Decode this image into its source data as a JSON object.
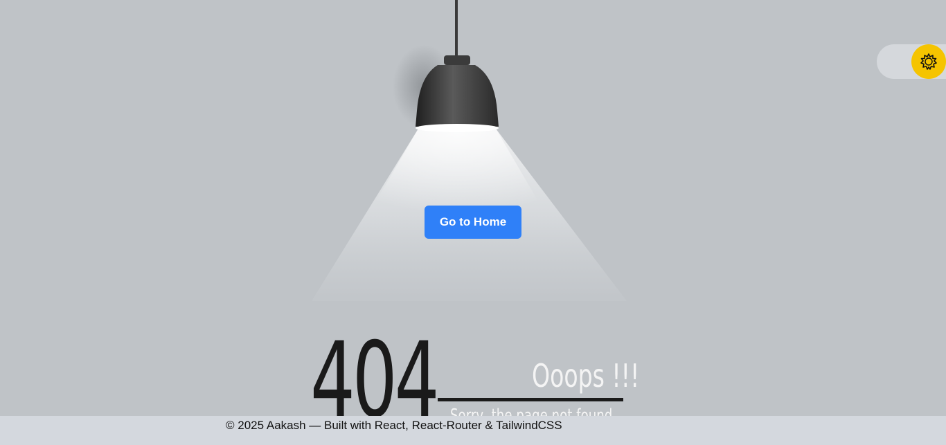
{
  "error": {
    "code": "404",
    "title": "Ooops !!!",
    "subtitle": "Sorry, the page not found"
  },
  "actions": {
    "home_label": "Go to Home"
  },
  "theme_toggle": {
    "icon": "sun-icon",
    "knob_color": "#f5c400"
  },
  "footer": {
    "text": "© 2025 Aakash — Built with React, React-Router & TailwindCSS"
  },
  "colors": {
    "background": "#bfc3c7",
    "button": "#2f80f8",
    "footer": "#d4d8de"
  }
}
